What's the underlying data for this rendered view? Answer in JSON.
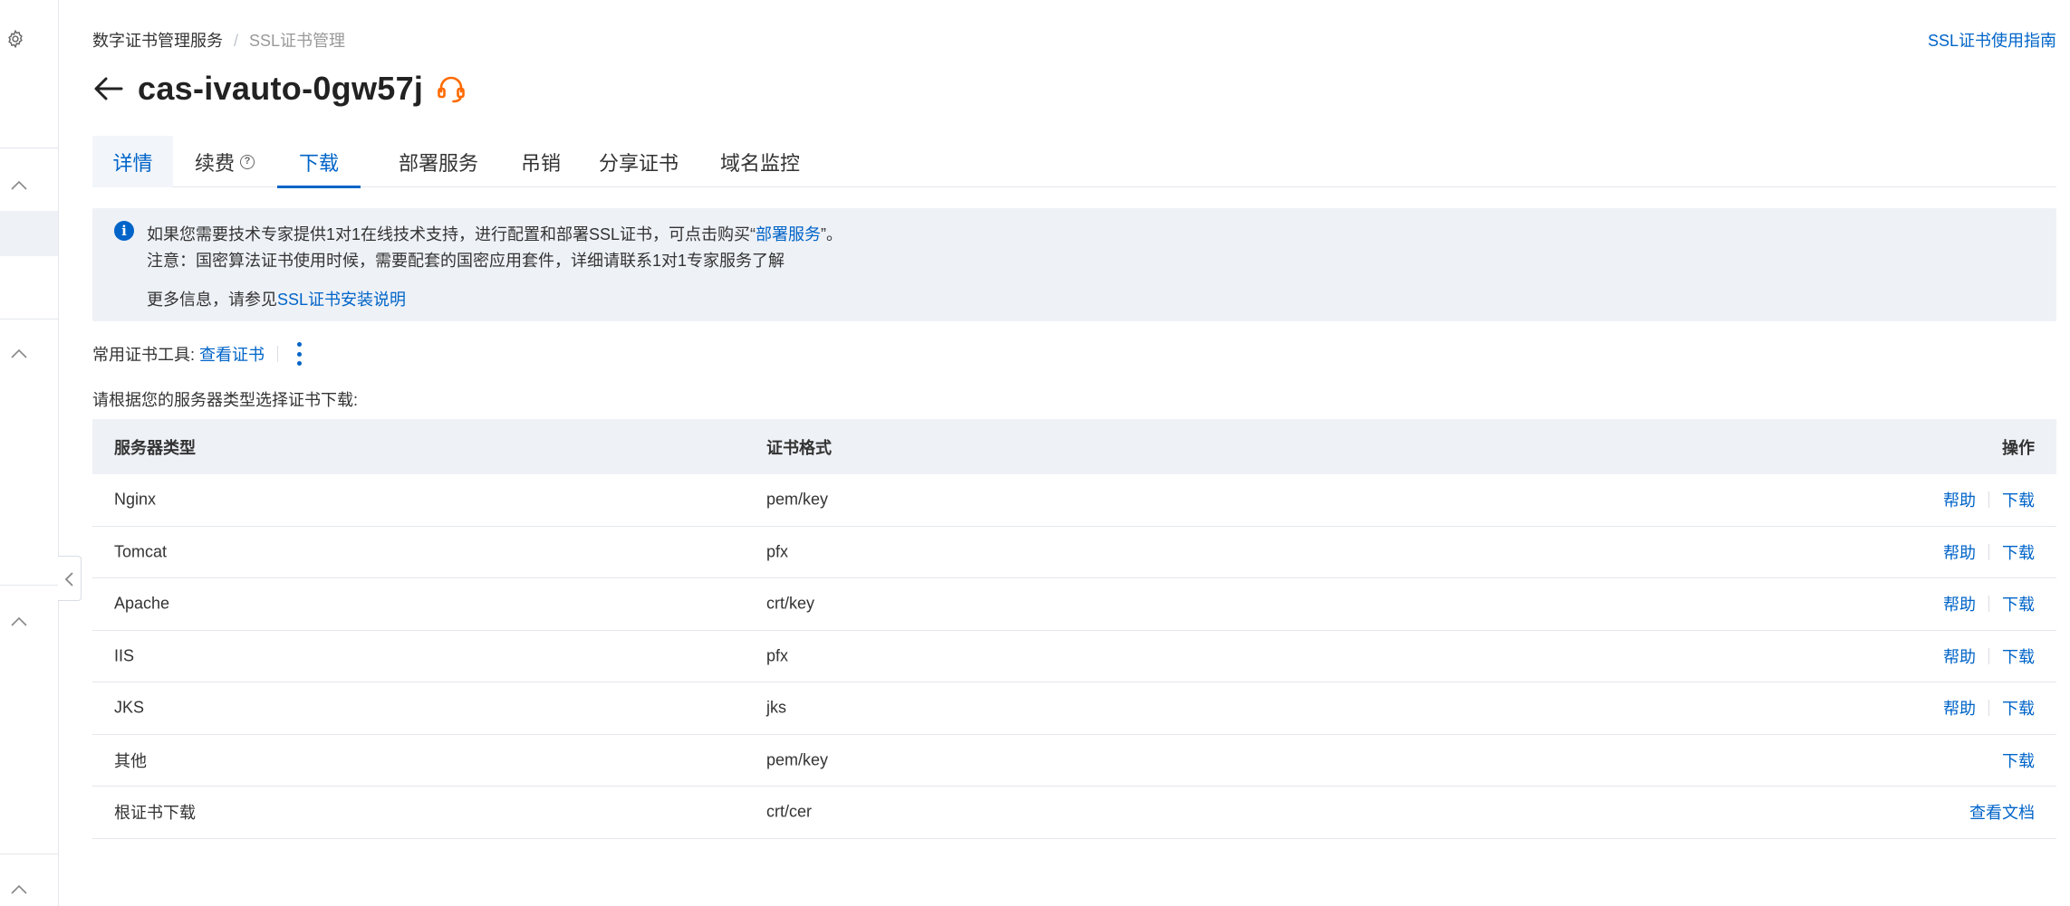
{
  "breadcrumb": {
    "parent": "数字证书管理服务",
    "current": "SSL证书管理"
  },
  "guide_link": "SSL证书使用指南",
  "title": "cas-ivauto-0gw57j",
  "tabs": [
    {
      "label": "详情"
    },
    {
      "label": "续费"
    },
    {
      "label": "下载"
    },
    {
      "label": "部署服务"
    },
    {
      "label": "吊销"
    },
    {
      "label": "分享证书"
    },
    {
      "label": "域名监控"
    }
  ],
  "active_tab": "下载",
  "notice": {
    "line1_prefix": "如果您需要技术专家提供1对1在线技术支持，进行配置和部署SSL证书，可点击购买“",
    "line1_link": "部署服务",
    "line1_suffix": "”。",
    "line2": "注意：国密算法证书使用时候，需要配套的国密应用套件，详细请联系1对1专家服务了解",
    "line3_prefix": "更多信息，请参见",
    "line3_link": "SSL证书安装说明"
  },
  "tools": {
    "label": "常用证书工具:",
    "link": "查看证书"
  },
  "instruction": "请根据您的服务器类型选择证书下载:",
  "table": {
    "headers": {
      "server_type": "服务器类型",
      "format": "证书格式",
      "action": "操作"
    },
    "rows": [
      {
        "server": "Nginx",
        "format": "pem/key",
        "help": "帮助",
        "download": "下载"
      },
      {
        "server": "Tomcat",
        "format": "pfx",
        "help": "帮助",
        "download": "下载"
      },
      {
        "server": "Apache",
        "format": "crt/key",
        "help": "帮助",
        "download": "下载"
      },
      {
        "server": "IIS",
        "format": "pfx",
        "help": "帮助",
        "download": "下载"
      },
      {
        "server": "JKS",
        "format": "jks",
        "help": "帮助",
        "download": "下载"
      },
      {
        "server": "其他",
        "format": "pem/key",
        "download": "下载"
      },
      {
        "server": "根证书下载",
        "format": "crt/cer",
        "docs": "查看文档"
      }
    ]
  },
  "colors": {
    "accent": "#0064c8",
    "support_icon": "#ff6a00",
    "notice_bg": "#eef1f6"
  },
  "icons": [
    "gear-icon",
    "chevron-up-icon",
    "chevron-left-icon",
    "back-arrow-icon",
    "headset-icon",
    "info-icon",
    "question-icon",
    "more-vertical-icon"
  ]
}
